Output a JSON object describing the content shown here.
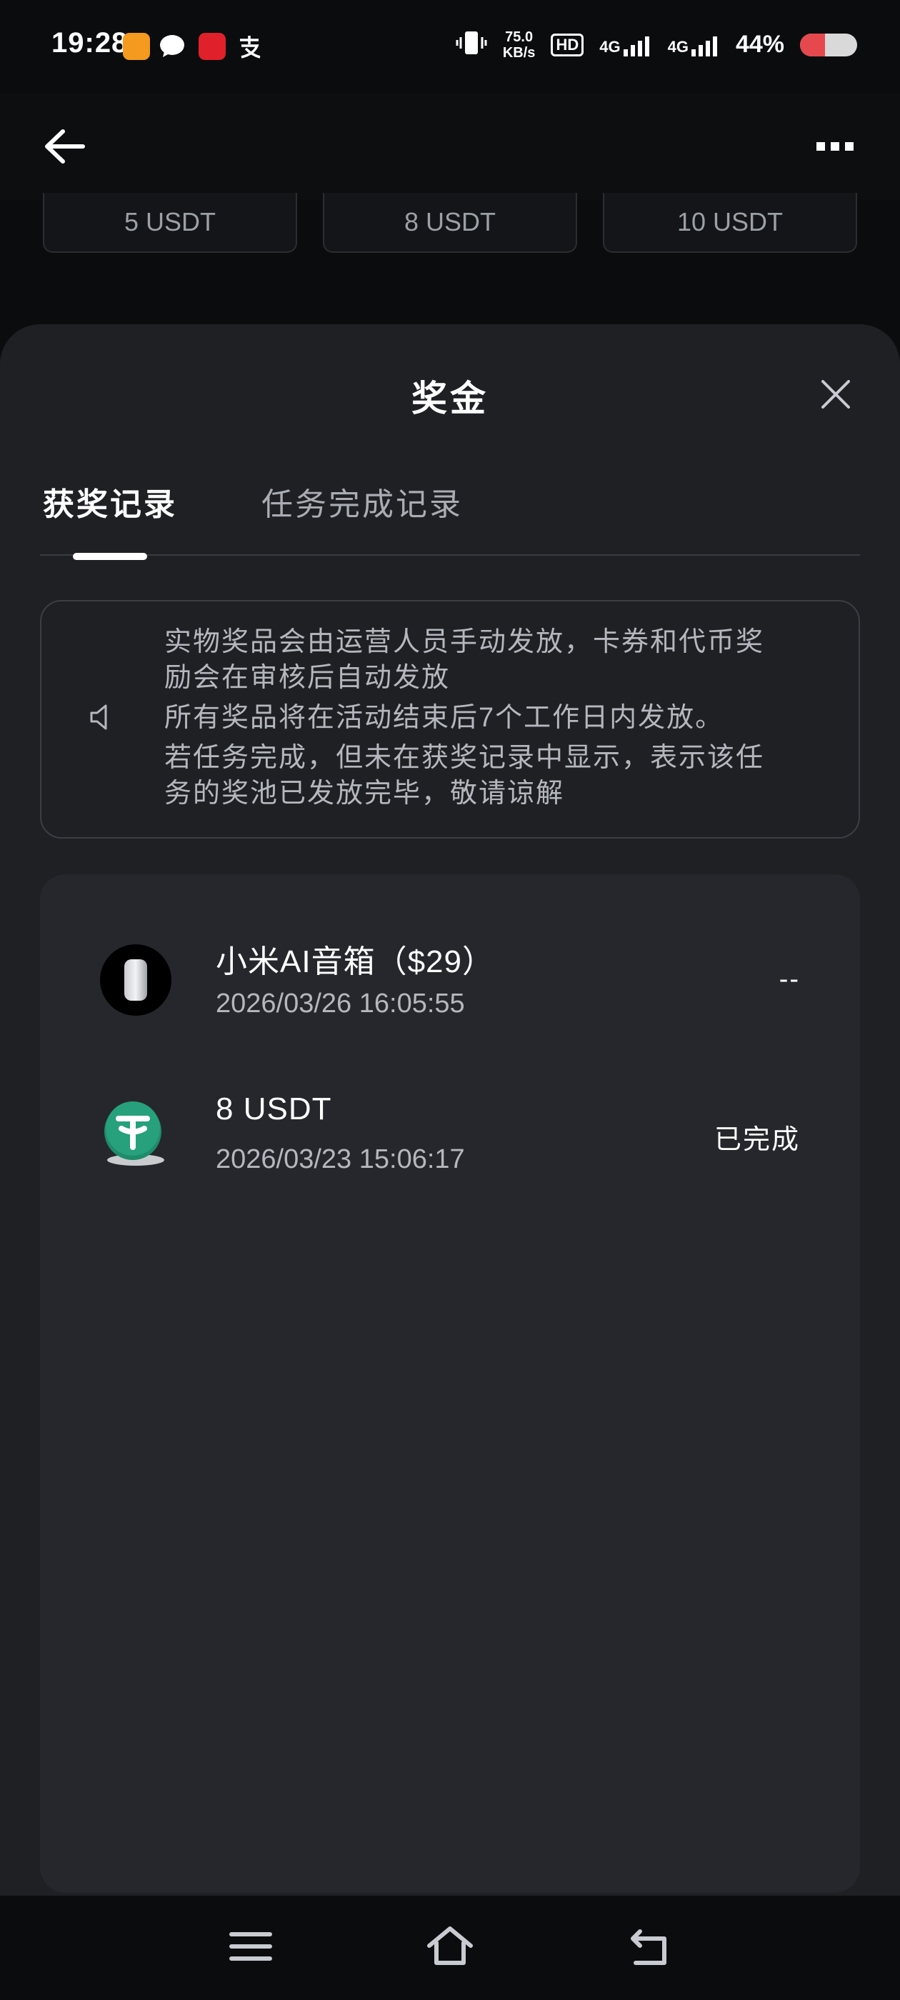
{
  "status_bar": {
    "time": "19:28",
    "speed_value": "75.0",
    "speed_unit": "KB/s",
    "hd_label": "HD",
    "network1": "4G",
    "network2": "4G",
    "battery_percent": "44%",
    "battery_level": 0.44,
    "app_icons": [
      "app-icon-orange",
      "message-icon",
      "app-icon-red",
      "alipay-icon"
    ]
  },
  "background_chips": [
    "5 USDT",
    "8 USDT",
    "10 USDT"
  ],
  "sheet": {
    "title": "奖金",
    "tabs": [
      {
        "label": "获奖记录",
        "active": true
      },
      {
        "label": "任务完成记录",
        "active": false
      }
    ],
    "notice_lines": [
      "实物奖品会由运营人员手动发放，卡券和代币奖",
      "励会在审核后自动发放",
      "所有奖品将在活动结束后7个工作日内发放。",
      "若任务完成，但未在获奖记录中显示，表示该任",
      "务的奖池已发放完毕，敬请谅解"
    ],
    "records": [
      {
        "name": "小米AI音箱（$29）",
        "time": "2026/03/26 16:05:55",
        "status": "--",
        "icon": "speaker-icon"
      },
      {
        "name": "8 USDT",
        "time": "2026/03/23 15:06:17",
        "status": "已完成",
        "icon": "usdt-coin-icon"
      }
    ]
  },
  "colors": {
    "background": "#0b0c0e",
    "sheet": "#1f2024",
    "card": "#26272c",
    "usdt_green": "#26a17b",
    "battery_red": "#e5484d"
  }
}
